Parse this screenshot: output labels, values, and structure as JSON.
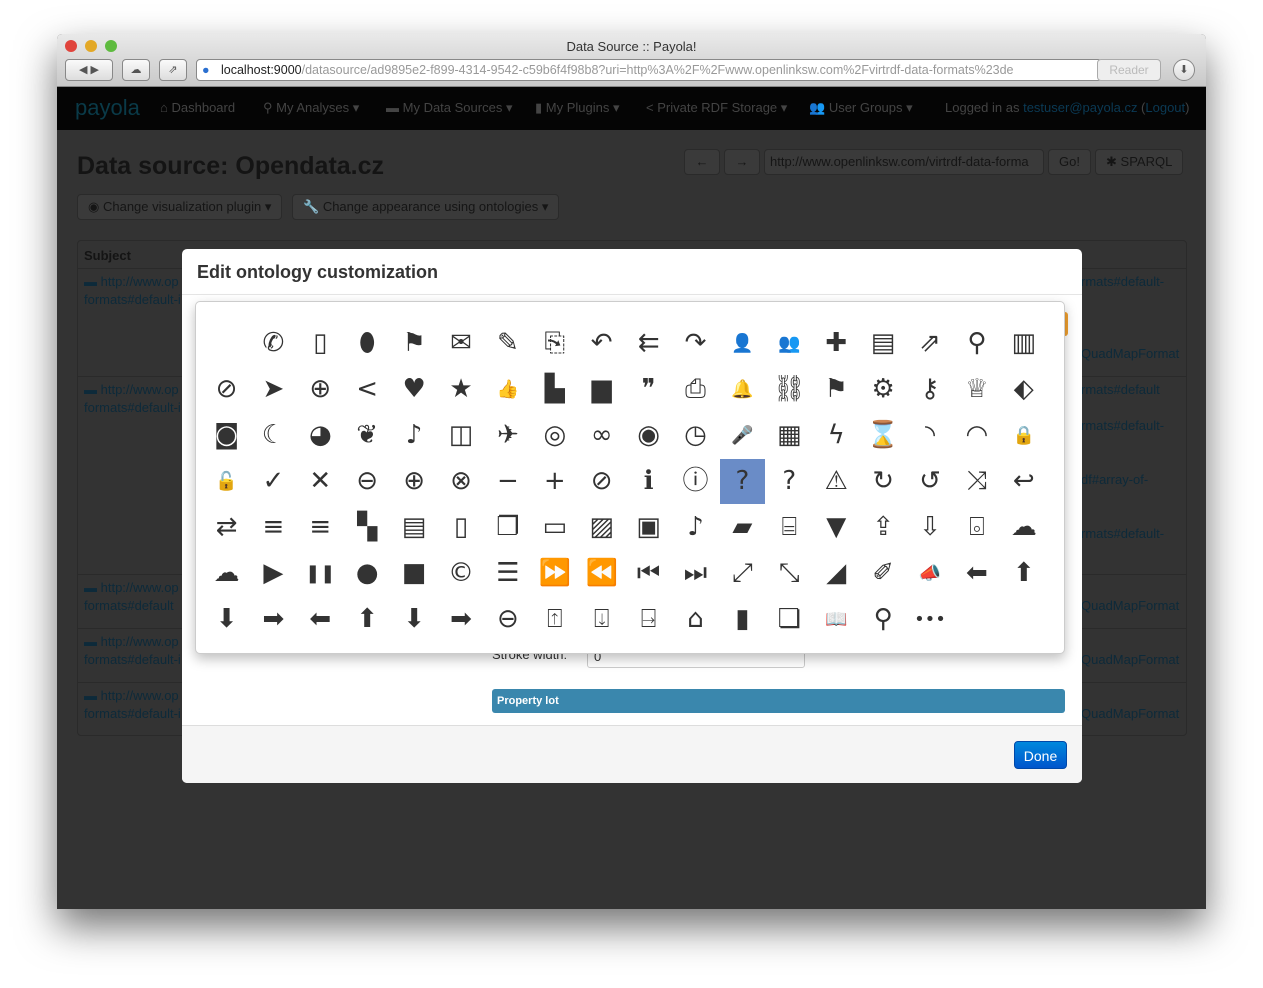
{
  "browser": {
    "title": "Data Source :: Payola!",
    "url_host": "localhost:9000",
    "url_path": "/datasource/ad9895e2-f899-4314-9542-c59b6f4f98b8?uri=http%3A%2F%2Fwww.openlinksw.com%2Fvirtrdf-data-formats%23de",
    "reader": "Reader"
  },
  "navbar": {
    "logo": "payola",
    "items": [
      {
        "icon": "⌂",
        "label": "Dashboard"
      },
      {
        "icon": "⚲",
        "label": "My Analyses"
      },
      {
        "icon": "▬",
        "label": "My Data Sources"
      },
      {
        "icon": "▮",
        "label": "My Plugins"
      },
      {
        "icon": "<",
        "label": "Private RDF Storage"
      },
      {
        "icon": "👥",
        "label": "User Groups"
      }
    ],
    "logged_in_prefix": "Logged in as ",
    "user": "testuser@payola.cz",
    "logout": "Logout"
  },
  "page": {
    "title": "Data source: Opendata.cz",
    "uri_input": "http://www.openlinksw.com/virtrdf-data-forma",
    "go": "Go!",
    "sparql": "SPARQL",
    "viz_button": "Change visualization plugin",
    "ont_button": "Change appearance using ontologies",
    "subject_header": "Subject",
    "left_cells": [
      [
        "http://www.op",
        "formats#default-i"
      ],
      [
        "http://www.op",
        "formats#default-i"
      ],
      [
        "http://www.op",
        "formats#default"
      ],
      [
        "http://www.op",
        "formats#default-i"
      ],
      [
        "http://www.op",
        "formats#default-i"
      ]
    ],
    "right_cells": [
      "rmats#default-",
      "QuadMapFormat",
      "rmats#default",
      "rmats#default-",
      "df#array-of-",
      "rmats#default-",
      "QuadMapFormat",
      "QuadMapFormat",
      "QuadMapFormat"
    ]
  },
  "modal": {
    "title": "Edit ontology customization",
    "stroke_label": "Stroke width:",
    "stroke_value": "0",
    "property_bar": "Property lot",
    "done": "Done",
    "icons": [
      [
        {
          "n": "blank",
          "g": ""
        },
        {
          "n": "phone",
          "g": "✆"
        },
        {
          "n": "mobile",
          "g": "▯"
        },
        {
          "n": "mouse",
          "g": "⬮"
        },
        {
          "n": "signpost",
          "g": "⚑"
        },
        {
          "n": "envelope",
          "g": "✉"
        },
        {
          "n": "pencil",
          "g": "✎"
        },
        {
          "n": "paperclip",
          "g": "⎘"
        },
        {
          "n": "reply",
          "g": "↶"
        },
        {
          "n": "reply-all",
          "g": "⇇"
        },
        {
          "n": "forward",
          "g": "↷"
        },
        {
          "n": "user",
          "g": "👤"
        },
        {
          "n": "group",
          "g": "👥"
        },
        {
          "n": "user-add",
          "g": "✚"
        },
        {
          "n": "vcard",
          "g": "▤"
        },
        {
          "n": "share",
          "g": "⇗"
        },
        {
          "n": "map-marker",
          "g": "⚲"
        },
        {
          "n": "map",
          "g": "▥"
        }
      ],
      [
        {
          "n": "compass",
          "g": "⊘"
        },
        {
          "n": "location-arrow",
          "g": "➤"
        },
        {
          "n": "crosshairs",
          "g": "⊕"
        },
        {
          "n": "share-alt",
          "g": "<"
        },
        {
          "n": "heart",
          "g": "♥"
        },
        {
          "n": "star",
          "g": "★"
        },
        {
          "n": "thumbs-up",
          "g": "👍"
        },
        {
          "n": "comments",
          "g": "▙"
        },
        {
          "n": "comment",
          "g": "▆"
        },
        {
          "n": "quote",
          "g": "❞"
        },
        {
          "n": "print",
          "g": "⎙"
        },
        {
          "n": "bell",
          "g": "🔔"
        },
        {
          "n": "link",
          "g": "⛓"
        },
        {
          "n": "flag",
          "g": "⚑"
        },
        {
          "n": "cog",
          "g": "⚙"
        },
        {
          "n": "flashlight",
          "g": "⚷"
        },
        {
          "n": "trophy",
          "g": "♕"
        },
        {
          "n": "tag",
          "g": "⬖"
        }
      ],
      [
        {
          "n": "camera",
          "g": "◙"
        },
        {
          "n": "moon",
          "g": "☾"
        },
        {
          "n": "palette",
          "g": "◕"
        },
        {
          "n": "leaf",
          "g": "❦"
        },
        {
          "n": "music",
          "g": "♪"
        },
        {
          "n": "shopping-bag",
          "g": "◫"
        },
        {
          "n": "plane",
          "g": "✈"
        },
        {
          "n": "life-ring",
          "g": "◎"
        },
        {
          "n": "unlink",
          "g": "∞"
        },
        {
          "n": "eye",
          "g": "◉"
        },
        {
          "n": "clock",
          "g": "◷"
        },
        {
          "n": "microphone",
          "g": "🎤"
        },
        {
          "n": "calendar",
          "g": "▦"
        },
        {
          "n": "bolt",
          "g": "ϟ"
        },
        {
          "n": "hourglass",
          "g": "⌛"
        },
        {
          "n": "rss",
          "g": "◝"
        },
        {
          "n": "wifi",
          "g": "◠"
        },
        {
          "n": "lock",
          "g": "🔒"
        }
      ],
      [
        {
          "n": "unlock",
          "g": "🔓"
        },
        {
          "n": "ok",
          "g": "✓"
        },
        {
          "n": "remove",
          "g": "✕"
        },
        {
          "n": "minus-sign",
          "g": "⊖"
        },
        {
          "n": "plus-sign",
          "g": "⊕"
        },
        {
          "n": "remove-sign",
          "g": "⊗"
        },
        {
          "n": "minus",
          "g": "−"
        },
        {
          "n": "plus",
          "g": "+"
        },
        {
          "n": "ban",
          "g": "⊘"
        },
        {
          "n": "info",
          "g": "ℹ"
        },
        {
          "n": "info-sign",
          "g": "ⓘ"
        },
        {
          "n": "question",
          "g": "?"
        },
        {
          "n": "question-sign",
          "g": "?"
        },
        {
          "n": "warning",
          "g": "⚠"
        },
        {
          "n": "refresh",
          "g": "↻"
        },
        {
          "n": "undo",
          "g": "↺"
        },
        {
          "n": "random",
          "g": "⤨"
        },
        {
          "n": "return",
          "g": "↩"
        }
      ],
      [
        {
          "n": "retweet",
          "g": "⇄"
        },
        {
          "n": "list",
          "g": "≡"
        },
        {
          "n": "list-add",
          "g": "≡"
        },
        {
          "n": "th-large",
          "g": "▚"
        },
        {
          "n": "file-text",
          "g": "▤"
        },
        {
          "n": "tablet",
          "g": "▯"
        },
        {
          "n": "copy",
          "g": "❐"
        },
        {
          "n": "rectangle",
          "g": "▭"
        },
        {
          "n": "picture",
          "g": "▨"
        },
        {
          "n": "film",
          "g": "▣"
        },
        {
          "n": "music-square",
          "g": "♪"
        },
        {
          "n": "folder-open",
          "g": "▰"
        },
        {
          "n": "inbox",
          "g": "⌸"
        },
        {
          "n": "trash",
          "g": "▼"
        },
        {
          "n": "upload",
          "g": "⇪"
        },
        {
          "n": "download",
          "g": "⇩"
        },
        {
          "n": "hdd",
          "g": "⌻"
        },
        {
          "n": "cloud",
          "g": "☁"
        }
      ],
      [
        {
          "n": "cloud-upload",
          "g": "☁"
        },
        {
          "n": "play",
          "g": "▶"
        },
        {
          "n": "pause",
          "g": "❚❚"
        },
        {
          "n": "circle",
          "g": "●"
        },
        {
          "n": "stop",
          "g": "■"
        },
        {
          "n": "cc",
          "g": "©"
        },
        {
          "n": "th-list",
          "g": "☰"
        },
        {
          "n": "fast-forward",
          "g": "⏩"
        },
        {
          "n": "backward",
          "g": "⏪"
        },
        {
          "n": "step-backward",
          "g": "⏮"
        },
        {
          "n": "step-forward",
          "g": "⏭"
        },
        {
          "n": "expand",
          "g": "⤢"
        },
        {
          "n": "compress",
          "g": "⤡"
        },
        {
          "n": "signal",
          "g": "◢"
        },
        {
          "n": "eyedropper",
          "g": "✐"
        },
        {
          "n": "bullhorn",
          "g": "📣"
        },
        {
          "n": "arrow-left",
          "g": "⬅"
        },
        {
          "n": "arrow-up",
          "g": "⬆"
        }
      ],
      [
        {
          "n": "arrow-down",
          "g": "⬇"
        },
        {
          "n": "arrow-right",
          "g": "➡"
        },
        {
          "n": "arrow-left-thin",
          "g": "⬅"
        },
        {
          "n": "arrow-up-thin",
          "g": "⬆"
        },
        {
          "n": "arrow-down-thin",
          "g": "⬇"
        },
        {
          "n": "arrow-right-thin",
          "g": "➡"
        },
        {
          "n": "circle-arrow-left",
          "g": "⊖"
        },
        {
          "n": "circle-arrow-up",
          "g": "⍐"
        },
        {
          "n": "circle-arrow-down",
          "g": "⍗"
        },
        {
          "n": "circle-arrow-right",
          "g": "⍈"
        },
        {
          "n": "home",
          "g": "⌂"
        },
        {
          "n": "bookmark",
          "g": "▮"
        },
        {
          "n": "clone",
          "g": "❏"
        },
        {
          "n": "book-open",
          "g": "📖"
        },
        {
          "n": "search",
          "g": "⚲"
        },
        {
          "n": "ellipsis",
          "g": "•••"
        }
      ]
    ],
    "selected_icon": "question"
  },
  "colors": {
    "selected": "#6a8cc7",
    "property_bar": "#3a87ad",
    "done": "#0070d0"
  }
}
